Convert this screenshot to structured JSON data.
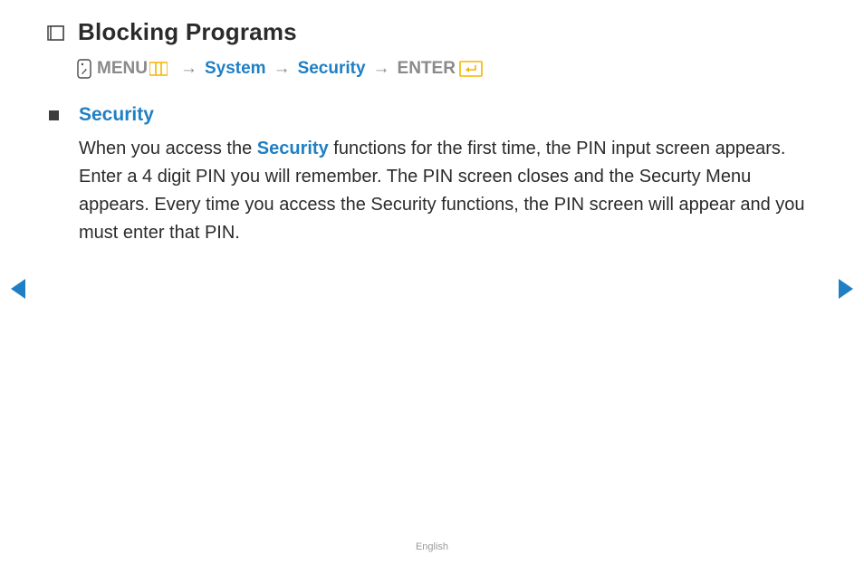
{
  "title": "Blocking Programs",
  "breadcrumb": {
    "menu": "MENU",
    "system": "System",
    "security": "Security",
    "enter": "ENTER",
    "arrow": "→"
  },
  "section": {
    "heading": "Security",
    "para_before": "When you access the ",
    "para_link": "Security",
    "para_after": " functions for the first time, the PIN input screen appears. Enter a 4 digit PIN you will remember. The PIN screen closes and the Securty Menu appears. Every time you access the Security functions, the PIN screen will appear and you must enter that PIN."
  },
  "footer": "English",
  "colors": {
    "link": "#1f7fc4",
    "muted": "#8a8a8a",
    "text": "#2b2b2b",
    "amber": "#f5b400"
  }
}
